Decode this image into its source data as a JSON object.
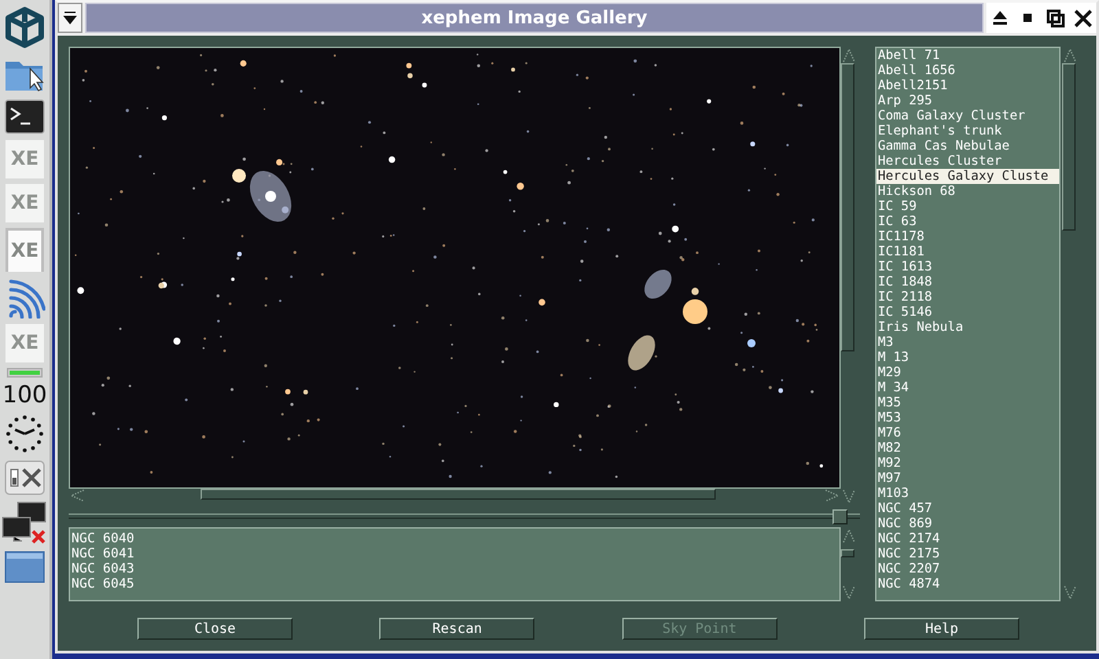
{
  "dock": {
    "items": [
      {
        "kind": "logo"
      },
      {
        "kind": "folder"
      },
      {
        "kind": "terminal"
      },
      {
        "kind": "app",
        "label": "XE",
        "selected": false
      },
      {
        "kind": "app",
        "label": "XE",
        "selected": false
      },
      {
        "kind": "app",
        "label": "XE",
        "selected": true
      },
      {
        "kind": "wifi"
      },
      {
        "kind": "app",
        "label": "XE",
        "selected": false
      },
      {
        "kind": "battery",
        "level": 1
      },
      {
        "kind": "text",
        "label": "100"
      },
      {
        "kind": "clock"
      },
      {
        "kind": "settings"
      },
      {
        "kind": "network"
      },
      {
        "kind": "window"
      }
    ]
  },
  "window": {
    "title": "xephem Image Gallery"
  },
  "gallery": {
    "items": [
      {
        "label": "Abell 71",
        "selected": false
      },
      {
        "label": "Abell 1656",
        "selected": false
      },
      {
        "label": "Abell2151",
        "selected": false
      },
      {
        "label": "Arp 295",
        "selected": false
      },
      {
        "label": "Coma Galaxy Cluster",
        "selected": false
      },
      {
        "label": "Elephant's trunk",
        "selected": false
      },
      {
        "label": "Gamma Cas Nebulae",
        "selected": false
      },
      {
        "label": "Hercules Cluster",
        "selected": false
      },
      {
        "label": "Hercules Galaxy Cluste",
        "selected": true
      },
      {
        "label": "Hickson 68",
        "selected": false
      },
      {
        "label": "IC 59",
        "selected": false
      },
      {
        "label": "IC 63",
        "selected": false
      },
      {
        "label": "IC1178",
        "selected": false
      },
      {
        "label": "IC1181",
        "selected": false
      },
      {
        "label": "IC 1613",
        "selected": false
      },
      {
        "label": "IC 1848",
        "selected": false
      },
      {
        "label": "IC 2118",
        "selected": false
      },
      {
        "label": "IC 5146",
        "selected": false
      },
      {
        "label": "Iris Nebula",
        "selected": false
      },
      {
        "label": "M3",
        "selected": false
      },
      {
        "label": "M 13",
        "selected": false
      },
      {
        "label": "M29",
        "selected": false
      },
      {
        "label": "M 34",
        "selected": false
      },
      {
        "label": "M35",
        "selected": false
      },
      {
        "label": "M53",
        "selected": false
      },
      {
        "label": "M76",
        "selected": false
      },
      {
        "label": "M82",
        "selected": false
      },
      {
        "label": "M92",
        "selected": false
      },
      {
        "label": "M97",
        "selected": false
      },
      {
        "label": "M103",
        "selected": false
      },
      {
        "label": "NGC 457",
        "selected": false
      },
      {
        "label": "NGC 869",
        "selected": false
      },
      {
        "label": "NGC 2174",
        "selected": false
      },
      {
        "label": "NGC 2175",
        "selected": false
      },
      {
        "label": "NGC 2207",
        "selected": false
      },
      {
        "label": "NGC 4874",
        "selected": false
      }
    ],
    "objects": [
      "NGC 6040",
      "NGC 6041",
      "NGC 6043",
      "NGC 6045"
    ]
  },
  "buttons": [
    {
      "label": "Close",
      "disabled": false
    },
    {
      "label": "Rescan",
      "disabled": false
    },
    {
      "label": "Sky Point",
      "disabled": true
    },
    {
      "label": "Help",
      "disabled": false
    }
  ]
}
